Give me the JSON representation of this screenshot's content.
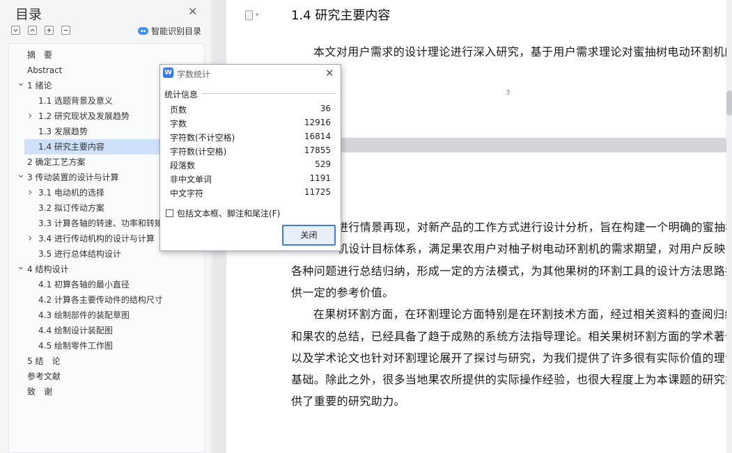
{
  "toc": {
    "title": "目录",
    "smart_label": "智能识别目录",
    "items": [
      {
        "label": "摘　要",
        "level": 0,
        "chevron": ""
      },
      {
        "label": "Abstract",
        "level": 0,
        "chevron": ""
      },
      {
        "label": "1 绪论",
        "level": 0,
        "chevron": "expanded"
      },
      {
        "label": "1.1 选题背景及意义",
        "level": 1,
        "chevron": ""
      },
      {
        "label": "1.2 研究现状及发展趋势",
        "level": 1,
        "chevron": "collapsed"
      },
      {
        "label": "1.3 发展趋势",
        "level": 1,
        "chevron": ""
      },
      {
        "label": "1.4 研究主要内容",
        "level": 1,
        "chevron": "",
        "active": true
      },
      {
        "label": "2 确定工艺方案",
        "level": 0,
        "chevron": ""
      },
      {
        "label": "3 传动装置的设计与计算",
        "level": 0,
        "chevron": "expanded"
      },
      {
        "label": "3.1 电动机的选择",
        "level": 1,
        "chevron": "collapsed"
      },
      {
        "label": "3.2 拟订传动方案",
        "level": 1,
        "chevron": ""
      },
      {
        "label": "3.3 计算各轴的转速、功率和转矩",
        "level": 1,
        "chevron": ""
      },
      {
        "label": "3.4 进行传动机构的设计与计算",
        "level": 1,
        "chevron": "collapsed"
      },
      {
        "label": "3.5 进行总体结构设计",
        "level": 1,
        "chevron": ""
      },
      {
        "label": "4 结构设计",
        "level": 0,
        "chevron": "expanded"
      },
      {
        "label": "4.1 初算各轴的最小直径",
        "level": 1,
        "chevron": ""
      },
      {
        "label": "4.2 计算各主要传动件的结构尺寸",
        "level": 1,
        "chevron": ""
      },
      {
        "label": "4.3 绘制部件的装配草图",
        "level": 1,
        "chevron": ""
      },
      {
        "label": "4.4 绘制设计装配图",
        "level": 1,
        "chevron": ""
      },
      {
        "label": "4.5 绘制零件工作图",
        "level": 1,
        "chevron": ""
      },
      {
        "label": "5 结　论",
        "level": 0,
        "chevron": ""
      },
      {
        "label": "参考文献",
        "level": 0,
        "chevron": ""
      },
      {
        "label": "致　谢",
        "level": 0,
        "chevron": ""
      }
    ]
  },
  "document": {
    "heading": "1.4 研究主要内容",
    "para1": "本文对用户需求的设计理论进行深入研究，基于用户需求理论对蜜抽树电动环割机的",
    "page_number": "3",
    "page2_lines": [
      "进行情景再现，对新产品的工作方式进行设计分析，旨在构建一个明确的蜜抽树",
      "机设计目标体系，满足果农用户对柚子树电动环割机的需求期望，对用户反映的",
      "各种问题进行总结归纳，形成一定的方法模式，为其他果树的环割工具的设计方法思路提",
      "供一定的参考价值。",
      "在果树环割方面，在环割理论方面特别是在环割技术方面，经过相关资料的查阅归纳",
      "和果农的总结，已经具备了趋于成熟的系统方法指导理论。相关果树环割方面的学术著作",
      "以及学术论文也针对环割理论展开了探讨与研究，为我们提供了许多很有实际价值的理论",
      "基础。除此之外，很多当地果农所提供的实际操作经验，也很大程度上为本课题的研究提",
      "供了重要的研究助力。"
    ]
  },
  "dialog": {
    "title": "字数统计",
    "section": "统计信息",
    "stats": [
      {
        "label": "页数",
        "value": "36"
      },
      {
        "label": "字数",
        "value": "12916"
      },
      {
        "label": "字符数(不计空格)",
        "value": "16814"
      },
      {
        "label": "字符数(计空格)",
        "value": "17855"
      },
      {
        "label": "段落数",
        "value": "529"
      },
      {
        "label": "非中文单词",
        "value": "1191"
      },
      {
        "label": "中文字符",
        "value": "11725"
      }
    ],
    "checkbox_label": "包括文本框、脚注和尾注(F)",
    "checkbox_checked": false,
    "close_label": "关闭"
  }
}
